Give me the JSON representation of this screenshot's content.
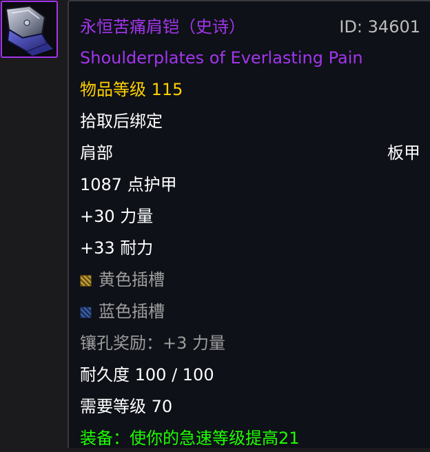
{
  "item": {
    "name_cn": "永恒苦痛肩铠（史诗）",
    "id_label": "ID: 34601",
    "name_en": "Shoulderplates of Everlasting Pain",
    "item_level": "物品等级 115",
    "bind": "拾取后绑定",
    "slot": "肩部",
    "armor_type": "板甲",
    "armor": "1087 点护甲",
    "stats": [
      "+30 力量",
      "+33 耐力"
    ],
    "sockets": [
      {
        "color": "yellow",
        "label": "黄色插槽"
      },
      {
        "color": "blue",
        "label": "蓝色插槽"
      }
    ],
    "socket_bonus": "镶孔奖励：+3 力量",
    "durability": "耐久度 100 / 100",
    "required_level": "需要等级 70",
    "equip_effect": "装备：使你的急速等级提高21",
    "icon": "shoulder-armor-icon"
  },
  "colors": {
    "epic": "#a335ee",
    "item_level": "#ffd100",
    "inactive": "#9d9d9d",
    "equip": "#1eff00",
    "background": "#0e1117",
    "text": "#ffffff"
  }
}
